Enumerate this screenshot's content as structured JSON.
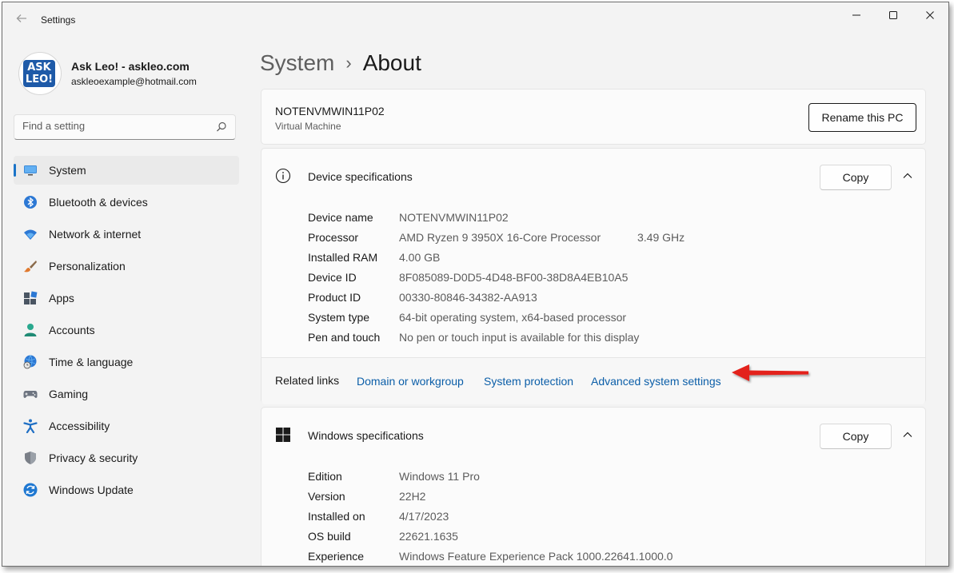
{
  "window": {
    "title": "Settings"
  },
  "profile": {
    "logo_line1": "ASK",
    "logo_line2": "LEO!",
    "name": "Ask Leo! - askleo.com",
    "email": "askleoexample@hotmail.com"
  },
  "search": {
    "placeholder": "Find a setting"
  },
  "nav": {
    "items": [
      {
        "label": "System",
        "icon": "monitor-icon",
        "active": true
      },
      {
        "label": "Bluetooth & devices",
        "icon": "bluetooth-icon"
      },
      {
        "label": "Network & internet",
        "icon": "wifi-icon"
      },
      {
        "label": "Personalization",
        "icon": "brush-icon"
      },
      {
        "label": "Apps",
        "icon": "apps-icon"
      },
      {
        "label": "Accounts",
        "icon": "person-icon"
      },
      {
        "label": "Time & language",
        "icon": "globe-clock-icon"
      },
      {
        "label": "Gaming",
        "icon": "gamepad-icon"
      },
      {
        "label": "Accessibility",
        "icon": "accessibility-icon"
      },
      {
        "label": "Privacy & security",
        "icon": "shield-icon"
      },
      {
        "label": "Windows Update",
        "icon": "update-icon"
      }
    ]
  },
  "breadcrumb": {
    "parent": "System",
    "separator": "›",
    "current": "About"
  },
  "pc": {
    "name": "NOTENVMWIN11P02",
    "type": "Virtual Machine",
    "rename_label": "Rename this PC"
  },
  "device_specs": {
    "title": "Device specifications",
    "copy_label": "Copy",
    "rows": [
      {
        "key": "Device name",
        "value": "NOTENVMWIN11P02"
      },
      {
        "key": "Processor",
        "value": "AMD Ryzen 9 3950X 16-Core Processor",
        "extra": "3.49 GHz"
      },
      {
        "key": "Installed RAM",
        "value": "4.00 GB"
      },
      {
        "key": "Device ID",
        "value": "8F085089-D0D5-4D48-BF00-38D8A4EB10A5"
      },
      {
        "key": "Product ID",
        "value": "00330-80846-34382-AA913"
      },
      {
        "key": "System type",
        "value": "64-bit operating system, x64-based processor"
      },
      {
        "key": "Pen and touch",
        "value": "No pen or touch input is available for this display"
      }
    ]
  },
  "related": {
    "label": "Related links",
    "links": [
      "Domain or workgroup",
      "System protection",
      "Advanced system settings"
    ]
  },
  "windows_specs": {
    "title": "Windows specifications",
    "copy_label": "Copy",
    "rows": [
      {
        "key": "Edition",
        "value": "Windows 11 Pro"
      },
      {
        "key": "Version",
        "value": "22H2"
      },
      {
        "key": "Installed on",
        "value": "4/17/2023"
      },
      {
        "key": "OS build",
        "value": "22621.1635"
      },
      {
        "key": "Experience",
        "value": "Windows Feature Experience Pack 1000.22641.1000.0"
      }
    ]
  },
  "colors": {
    "accent": "#1b74c8",
    "link": "#0b5ea8",
    "annotation_arrow": "#e3211b"
  }
}
